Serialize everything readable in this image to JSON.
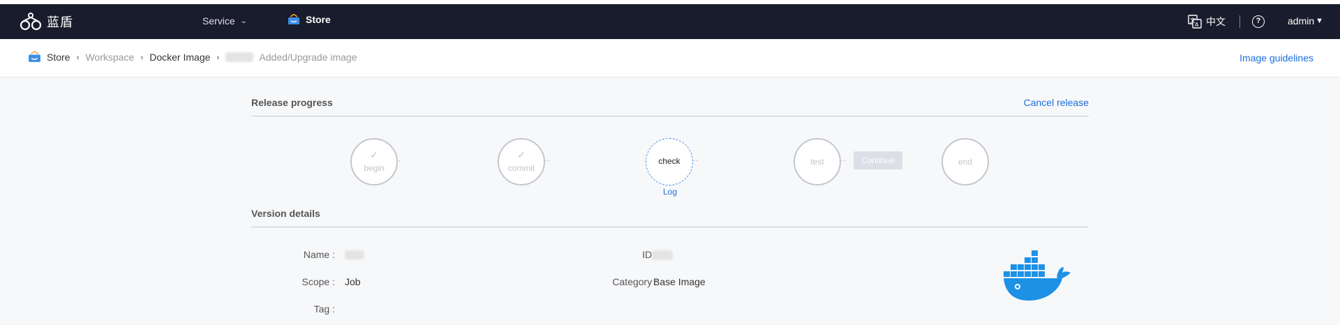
{
  "header": {
    "logo_text": "蓝盾",
    "nav_service": "Service",
    "nav_store": "Store",
    "lang": "中文",
    "help": "?",
    "user": "admin"
  },
  "breadcrumb": {
    "items": [
      "Store",
      "Workspace",
      "Docker Image"
    ],
    "current": "Added/Upgrade image",
    "guidelines": "Image guidelines"
  },
  "release": {
    "title": "Release progress",
    "cancel": "Cancel release",
    "steps": [
      {
        "label": "begin",
        "state": "done"
      },
      {
        "label": "commit",
        "state": "done"
      },
      {
        "label": "check",
        "state": "active"
      },
      {
        "label": "test",
        "state": "pending"
      },
      {
        "label": "end",
        "state": "pending"
      }
    ],
    "log_link": "Log",
    "continue_label": "Continue"
  },
  "version": {
    "title": "Version details",
    "name_label": "Name :",
    "id_label": "ID :",
    "scope_label": "Scope :",
    "scope_value": "Job",
    "category_label": "Category :",
    "category_value": "Base Image",
    "tag_label": "Tag :",
    "tag_value": ""
  },
  "colors": {
    "navbar": "#191c2c",
    "link": "#1a6fe0",
    "docker": "#1d91e6"
  }
}
